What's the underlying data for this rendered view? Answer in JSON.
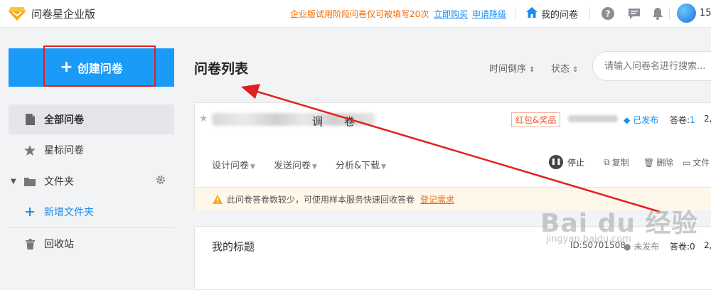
{
  "header": {
    "app_title": "问卷星企业版",
    "trial_notice": "企业版试用阶段问卷仅可被填写20次",
    "buy_link": "立即购买",
    "downgrade_link": "申请降级",
    "my_questionnaires": "我的问卷",
    "username": "15",
    "icons": [
      "diamond-logo-icon",
      "home-icon",
      "help-icon",
      "message-icon",
      "bell-icon"
    ]
  },
  "sidebar": {
    "create_label": "创建问卷",
    "items": [
      {
        "label": "全部问卷",
        "icon": "file-icon",
        "active": true
      },
      {
        "label": "星标问卷",
        "icon": "star-icon"
      },
      {
        "label": "文件夹",
        "icon": "folder-icon"
      },
      {
        "label": "新增文件夹",
        "icon": "plus-icon"
      },
      {
        "label": "回收站",
        "icon": "trash-icon"
      }
    ]
  },
  "main": {
    "title": "问卷列表",
    "sort_time": "时间倒序",
    "sort_status": "状态",
    "search_placeholder": "请输入问卷名进行搜索..."
  },
  "cards": [
    {
      "title_fragments": [
        "调",
        "卷"
      ],
      "tag": "红包&奖品",
      "status": "已发布",
      "answers_label": "答卷:",
      "answers_count": "1",
      "page": "2,",
      "actions": [
        "设计问卷",
        "发送问卷",
        "分析&下载"
      ],
      "stop_label": "停止",
      "ops": [
        "复制",
        "删除",
        "文件"
      ],
      "notice_text": "此问卷答卷数较少，可使用样本服务快速回收答卷",
      "notice_link": "登记需求"
    },
    {
      "title": "我的标题",
      "id_text": "ID:50701508",
      "status": "未发布",
      "answers_label": "答卷:",
      "answers_count": "0",
      "page": "2,"
    }
  ],
  "watermark": {
    "main": "Bai du 经验",
    "sub": "jingyan.baidu.com"
  },
  "colors": {
    "brand_blue": "#1a9bf7",
    "link_blue": "#1a8cf0",
    "warning_orange": "#f56a00",
    "annotation_red": "#e02020"
  }
}
